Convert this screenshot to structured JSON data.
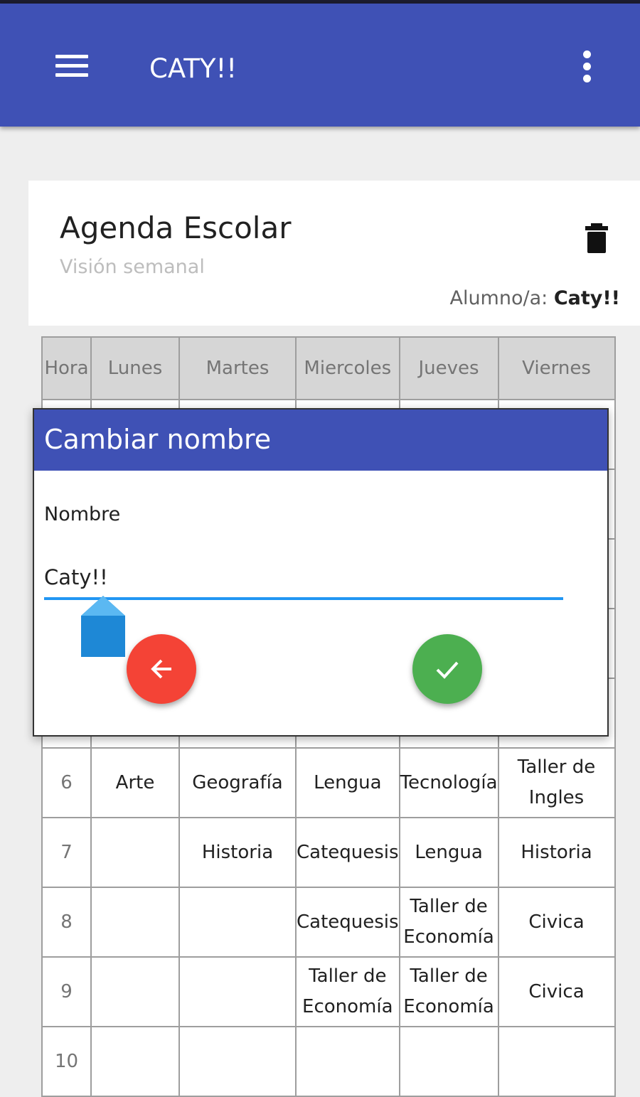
{
  "app_bar": {
    "title": "CATY!!",
    "menu_icon": "hamburger-menu-icon",
    "more_icon": "more-vert-icon",
    "color": "#3f51b5"
  },
  "card": {
    "title": "Agenda Escolar",
    "subtitle": "Visión semanal",
    "student_label": "Alumno/a:",
    "student_name": "Caty!!",
    "delete_icon": "trash-icon"
  },
  "schedule": {
    "headers": [
      "Hora",
      "Lunes",
      "Martes",
      "Miercoles",
      "Jueves",
      "Viernes"
    ],
    "rows": [
      [
        "",
        "",
        "",
        "",
        "",
        ""
      ],
      [
        "",
        "",
        "",
        "",
        "",
        ""
      ],
      [
        "",
        "",
        "",
        "",
        "",
        ""
      ],
      [
        "",
        "",
        "",
        "",
        "",
        ""
      ],
      [
        "",
        "",
        "",
        "",
        "",
        ""
      ],
      [
        "6",
        "Arte",
        "Geografía",
        "Lengua",
        "Tecnología",
        "Taller de Ingles"
      ],
      [
        "7",
        "",
        "Historia",
        "Catequesis",
        "Lengua",
        "Historia"
      ],
      [
        "8",
        "",
        "",
        "Catequesis",
        "Taller de Economía",
        "Civica"
      ],
      [
        "9",
        "",
        "",
        "Taller de Economía",
        "Taller de Economía",
        "Civica"
      ],
      [
        "10",
        "",
        "",
        "",
        "",
        ""
      ]
    ]
  },
  "dialog": {
    "title": "Cambiar nombre",
    "field_label": "Nombre",
    "field_value": "Caty!!",
    "back_icon": "arrow-back-icon",
    "confirm_icon": "check-icon",
    "back_color": "#f44336",
    "confirm_color": "#4caf50",
    "accent": "#2196f3"
  }
}
